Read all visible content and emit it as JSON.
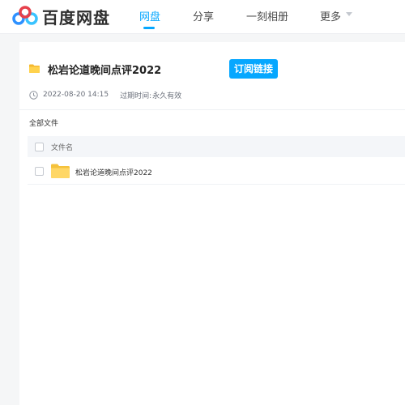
{
  "header": {
    "logo_text": "百度网盘",
    "nav": [
      {
        "label": "网盘",
        "active": true
      },
      {
        "label": "分享",
        "active": false
      },
      {
        "label": "一刻相册",
        "active": false
      },
      {
        "label": "更多",
        "active": false
      }
    ]
  },
  "share": {
    "title": "松岩论道晚间点评2022",
    "subscribe_label": "订阅链接",
    "date": "2022-08-20 14:15",
    "expire_label": "过期时间:",
    "expire_value": "永久有效"
  },
  "file_list": {
    "breadcrumb": "全部文件",
    "column_header": "文件名",
    "rows": [
      {
        "name": "松岩论道晚间点评2022",
        "type": "folder"
      }
    ]
  },
  "colors": {
    "accent": "#06a7ff",
    "folder": "#ffd24d"
  },
  "icons": {
    "logo": "baidu-cloud-logo-icon",
    "clock": "clock-icon",
    "folder": "folder-icon",
    "caret": "caret-down-icon"
  }
}
